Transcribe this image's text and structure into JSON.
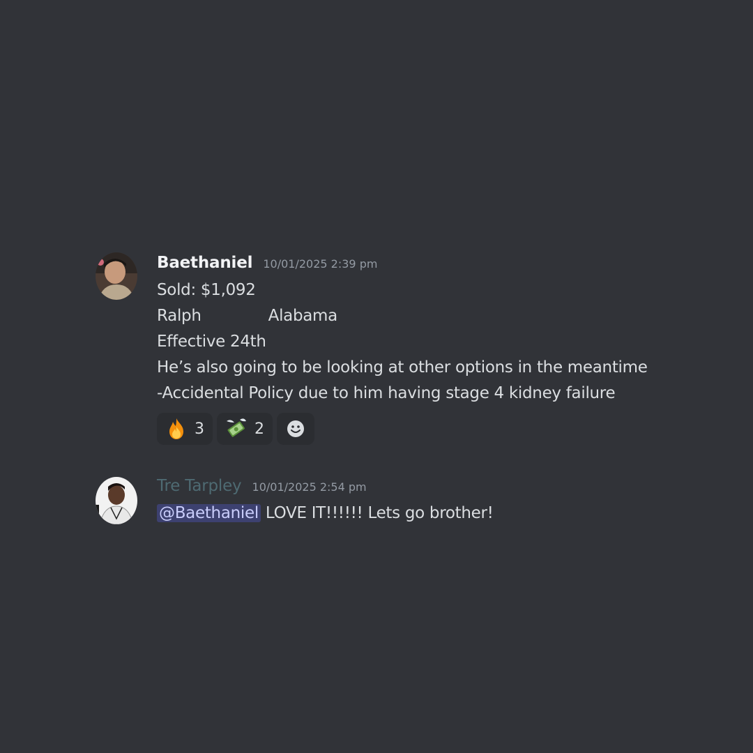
{
  "messages": [
    {
      "author": "Baethaniel",
      "timestamp": "10/01/2025 2:39 pm",
      "lines": {
        "sold": "Sold: $1,092",
        "name": "Ralph",
        "state": "Alabama",
        "effective": "Effective 24th",
        "note": "He’s also going to be looking at other options in the meantime",
        "policy": "-Accidental Policy due to him having stage 4 kidney failure"
      },
      "reactions": [
        {
          "emoji": "fire-icon",
          "count": "3"
        },
        {
          "emoji": "money-with-wings-icon",
          "count": "2"
        }
      ]
    },
    {
      "author": "Tre Tarpley",
      "timestamp": "10/01/2025 2:54 pm",
      "mention": "@Baethaniel",
      "text": " LOVE IT!!!!!! Lets go brother!"
    }
  ],
  "colors": {
    "background": "#313338",
    "reaction_bg": "#2b2d31",
    "mention_bg": "#5865f24d",
    "muted_author": "#4e6a72"
  }
}
